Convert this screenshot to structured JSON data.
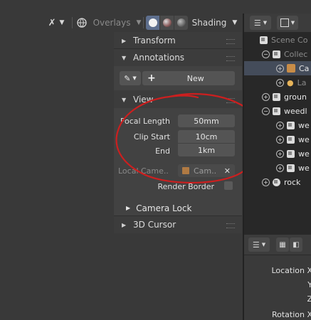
{
  "header": {
    "overlays_label": "Overlays",
    "shading_label": "Shading",
    "chevron": "⌄"
  },
  "npanel": {
    "transform_label": "Transform",
    "annotations_label": "Annotations",
    "new_label": "New",
    "view_label": "View",
    "focal_length_label": "Focal Length",
    "focal_length_value": "50mm",
    "clip_start_label": "Clip Start",
    "clip_start_value": "10cm",
    "end_label": "End",
    "end_value": "1km",
    "local_camera_label": "Local Came..",
    "local_camera_value": "Cam..",
    "render_border_label": "Render Border",
    "camera_lock_label": "Camera Lock",
    "cursor_label": "3D Cursor"
  },
  "outliner": {
    "items": [
      {
        "label": "Scene Co"
      },
      {
        "label": "Collec"
      },
      {
        "label": "Ca"
      },
      {
        "label": "La"
      },
      {
        "label": "groun"
      },
      {
        "label": "weedl"
      },
      {
        "label": "we"
      },
      {
        "label": "we"
      },
      {
        "label": "we"
      },
      {
        "label": "we"
      },
      {
        "label": "rock"
      }
    ]
  },
  "properties": {
    "location_label": "Location X",
    "y_label": "Y",
    "z_label": "Z",
    "rotation_label": "Rotation X"
  },
  "colors": {
    "accent": "#cc1f1f",
    "selection": "#444c5a"
  }
}
